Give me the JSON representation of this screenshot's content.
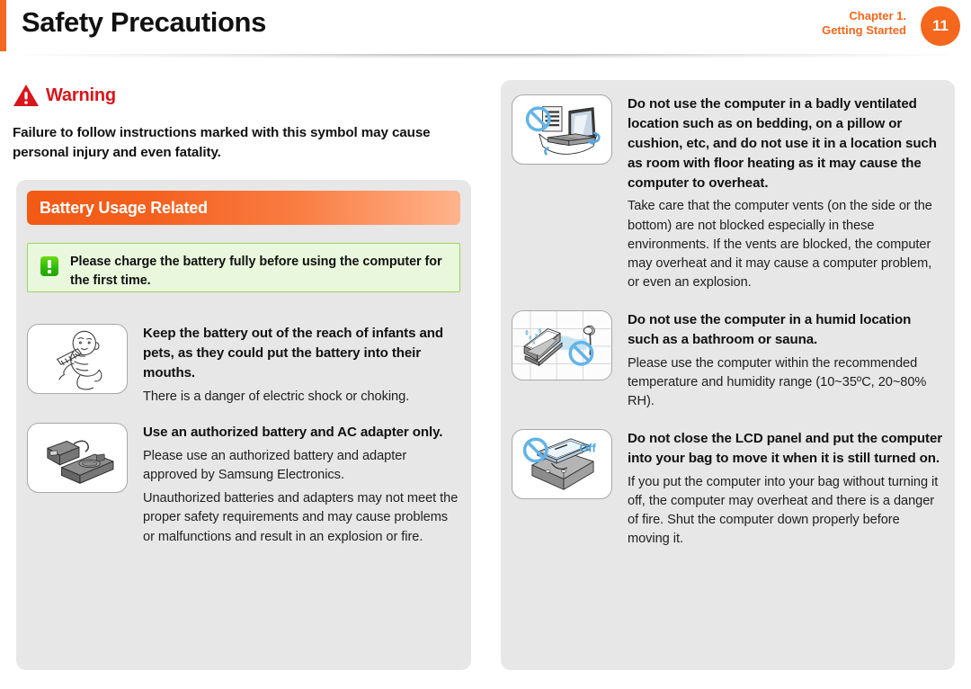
{
  "header": {
    "title": "Safety Precautions",
    "chapter_line1": "Chapter 1.",
    "chapter_line2": "Getting Started",
    "page_number": "11",
    "accent_color": "#f4671c"
  },
  "warning": {
    "icon": "warning-triangle-icon",
    "label": "Warning",
    "label_color": "#d8161b",
    "description": "Failure to follow instructions marked with this symbol may cause personal injury and even fatality."
  },
  "left_panel": {
    "section_title": "Battery Usage Related",
    "section_bar_color_start": "#f25a15",
    "section_bar_color_end": "#feb48d",
    "note": {
      "icon": "exclamation-note-icon",
      "text": "Please charge the battery fully before using the computer for the first time.",
      "background": "#e9f8dd",
      "border_color": "#9ad55c"
    },
    "items": [
      {
        "icon": "infant-with-battery-icon",
        "title": "Keep the battery out of the reach of infants and pets, as they could put the battery into their mouths.",
        "paragraphs": [
          "There is a danger of electric shock or choking."
        ]
      },
      {
        "icon": "ac-adapter-and-battery-icon",
        "title": "Use an authorized battery and AC adapter only.",
        "paragraphs": [
          "Please use an authorized battery and adapter approved by Samsung Electronics.",
          "Unauthorized batteries and adapters may not meet the proper safety requirements and may cause problems or malfunctions and result in an explosion or fire."
        ]
      }
    ]
  },
  "right_panel": {
    "items": [
      {
        "icon": "laptop-on-bedding-prohibited-icon",
        "title": "Do not use the computer in a badly ventilated location such as on bedding, on a pillow or cushion, etc, and do not use it in a location such as room with floor heating as it may cause the computer to overheat.",
        "paragraphs": [
          "Take care that the computer vents (on the side or the bottom) are not blocked especially in these environments. If the vents are blocked, the computer may overheat and it may cause a computer problem, or even an explosion."
        ]
      },
      {
        "icon": "laptop-in-humid-bathroom-prohibited-icon",
        "title": "Do not use the computer in a humid location such as a bathroom or sauna.",
        "paragraphs": [
          "Please use the computer within the recommended temperature and humidity range (10~35ºC, 20~80% RH)."
        ]
      },
      {
        "icon": "laptop-in-bag-powered-on-prohibited-icon",
        "icon_label": "Off",
        "title": "Do not close the LCD panel and put the computer into your bag to move it when it is still turned on.",
        "paragraphs": [
          "If you put the computer into your bag without turning it off, the computer may overheat and there is a danger of fire. Shut the computer down properly before moving it."
        ]
      }
    ]
  }
}
